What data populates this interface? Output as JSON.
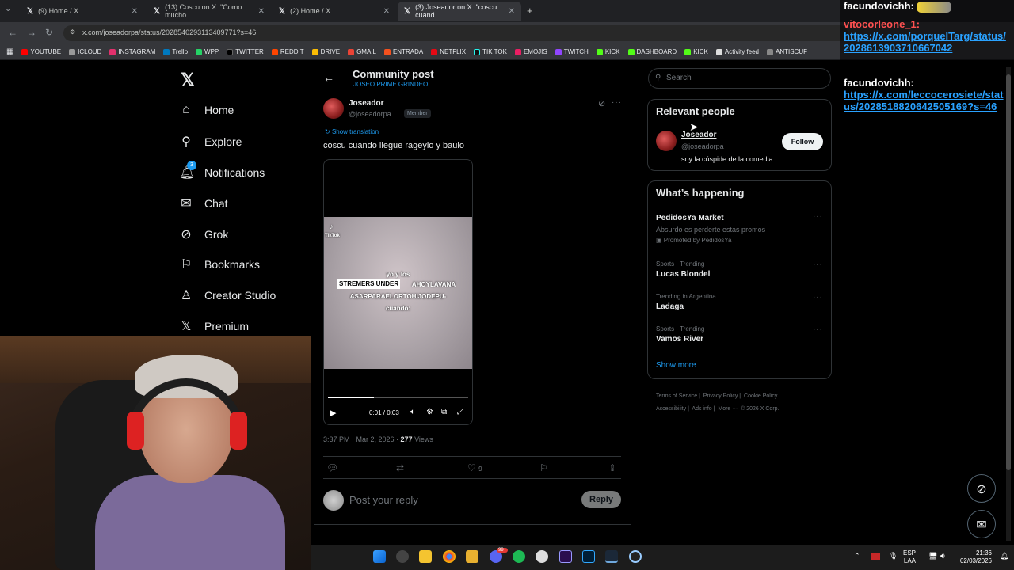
{
  "browser": {
    "tabs": [
      {
        "label": "(9) Home / X"
      },
      {
        "label": "(13) Coscu on X: \"Como mucho"
      },
      {
        "label": "(2) Home / X"
      },
      {
        "label": "(3) Joseador on X: \"coscu cuand"
      }
    ],
    "url": "x.com/joseadorpa/status/2028540293113409771?s=46",
    "bookmarks": [
      "YOUTUBE",
      "ICLOUD",
      "INSTAGRAM",
      "Trello",
      "WPP",
      "TWITTER",
      "REDDIT",
      "DRIVE",
      "GMAIL",
      "ENTRADA",
      "NETFLIX",
      "TIK TOK",
      "EMOJIS",
      "TWITCH",
      "KICK",
      "DASHBOARD",
      "KICK",
      "Activity feed",
      "ANTISCUF"
    ]
  },
  "nav": {
    "items": [
      {
        "label": "Home",
        "icon": "home-icon"
      },
      {
        "label": "Explore",
        "icon": "search-icon"
      },
      {
        "label": "Notifications",
        "icon": "bell-icon",
        "badge": "3"
      },
      {
        "label": "Chat",
        "icon": "mail-icon"
      },
      {
        "label": "Grok",
        "icon": "grok-icon"
      },
      {
        "label": "Bookmarks",
        "icon": "bookmark-icon"
      },
      {
        "label": "Creator Studio",
        "icon": "creator-icon"
      },
      {
        "label": "Premium",
        "icon": "x-icon"
      }
    ]
  },
  "header": {
    "title": "Community post",
    "subtitle": "JOSEO PRIME GRINDEO"
  },
  "post": {
    "author": "Joseador",
    "handle": "@joseadorpa",
    "role": "Member",
    "show_translation": "Show translation",
    "text": "coscu cuando llegue rageylo y baulo",
    "video": {
      "overlay_lines": [
        "yo y los",
        "STREMERS UNDER",
        "AHOYLAVANA",
        "ASARPARAELORTOHIJODEPU-",
        "cuando:"
      ],
      "watermark": "TikTok",
      "time": "0:01 / 0:03",
      "progress": 0.33
    },
    "timestamp": "3:37 PM · Mar 2, 2026 · ",
    "views": "277",
    "views_label": " Views",
    "likes": "9"
  },
  "reply": {
    "placeholder": "Post your reply",
    "button": "Reply"
  },
  "sidebar": {
    "search_placeholder": "Search",
    "relevant_title": "Relevant people",
    "person": {
      "name": "Joseador",
      "handle": "@joseadorpa",
      "bio": "soy la cúspide de la comedia",
      "follow": "Follow"
    },
    "happening_title": "What’s happening",
    "trends": [
      {
        "meta": "",
        "name": "PedidosYa Market",
        "desc": "Absurdo es perderte estas promos",
        "promo": "Promoted by PedidosYa"
      },
      {
        "meta": "Sports · Trending",
        "name": "Lucas Blondel"
      },
      {
        "meta": "Trending in Argentina",
        "name": "Ladaga"
      },
      {
        "meta": "Sports · Trending",
        "name": "Vamos River"
      }
    ],
    "show_more": "Show more",
    "footer": [
      "Terms of Service",
      "Privacy Policy",
      "Cookie Policy",
      "Accessibility",
      "Ads info",
      "More ···",
      "© 2026 X Corp."
    ]
  },
  "chat_overlay": [
    {
      "user": "facundovichh:",
      "link": ""
    },
    {
      "user": "vitocorleone_1:",
      "link": "https://x.com/porquelTarg/status/2028613903710667042"
    },
    {
      "user": "facundovichh:",
      "link": "https://x.com/leccocerosiete/status/2028518820642505169?s=46"
    }
  ],
  "tray": {
    "lang": "ESP",
    "lang2": "LAA",
    "time": "21:36",
    "date": "02/03/2026",
    "badge": "99+"
  },
  "colors": {
    "accent": "#1d9bf0",
    "bg": "#000000",
    "chat_link": "#2aa2ff"
  }
}
